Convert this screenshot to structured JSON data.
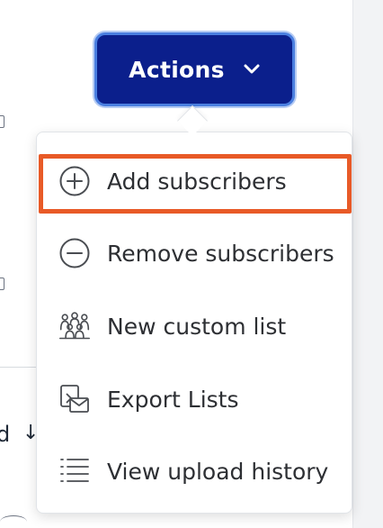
{
  "actions_button": {
    "label": "Actions",
    "icon": "chevron-down-icon",
    "background": "#0b1f8c",
    "focus_ring": "#4a7fe0"
  },
  "menu": {
    "items": [
      {
        "label": "Add subscribers",
        "icon": "plus-circle-icon",
        "highlighted": true
      },
      {
        "label": "Remove subscribers",
        "icon": "minus-circle-icon"
      },
      {
        "label": "New custom list",
        "icon": "people-group-icon"
      },
      {
        "label": "Export Lists",
        "icon": "export-mail-icon"
      },
      {
        "label": "View upload history",
        "icon": "list-icon"
      }
    ],
    "highlight_color": "#e85a27"
  }
}
